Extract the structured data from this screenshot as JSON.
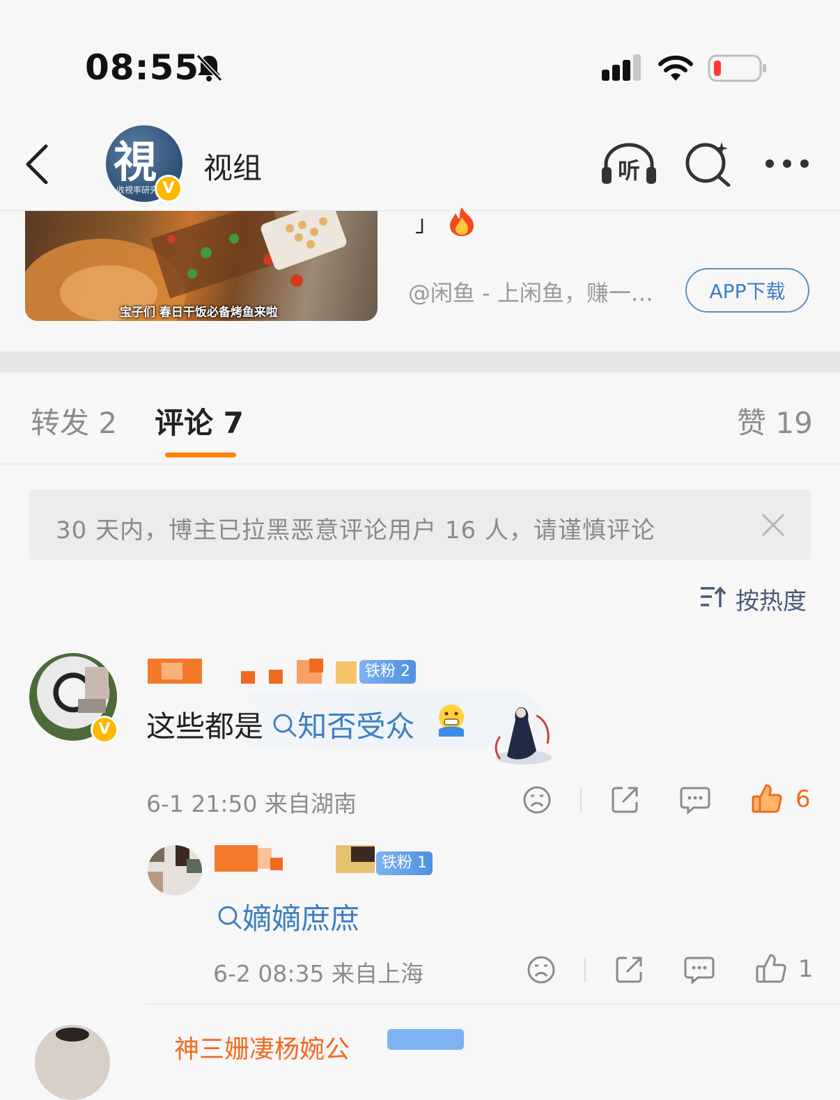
{
  "status_bar": {
    "time": "08:55"
  },
  "header": {
    "title": "视组",
    "avatar_glyph": "視",
    "avatar_subtext": "收視率研究"
  },
  "post": {
    "thumbnail_caption": "宝子们 春日干饭必备烤鱼来啦",
    "ad_text": "@闲鱼 - 上闲鱼，赚一…",
    "app_button": "APP下载",
    "partial_text": "」"
  },
  "tabs": {
    "repost": "转发 2",
    "comments": "评论 7",
    "likes": "赞 19"
  },
  "notice": {
    "text": "30 天内，博主已拉黑恶意评论用户 16 人，请谨慎评论"
  },
  "sort": {
    "label": "按热度"
  },
  "comments": [
    {
      "fan_badge": "铁粉 2",
      "text_prefix": "这些都是 ",
      "topic": "知否受众",
      "meta": "6-1 21:50  来自湖南",
      "likes": "6"
    },
    {
      "fan_badge": "铁粉 1",
      "topic": "嫡嫡庶庶",
      "meta": "6-2 08:35  来自上海",
      "likes": "1"
    }
  ],
  "next_comment": {
    "name_partial": "神三姗凄杨婉公"
  },
  "colors": {
    "accent": "#ff8200",
    "link": "#3e7ec4",
    "like_active": "#f06a1f"
  }
}
